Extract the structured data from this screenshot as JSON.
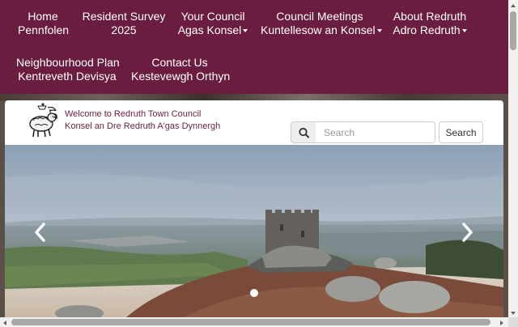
{
  "nav": {
    "items": [
      {
        "line1": "Home",
        "line2": "Pennfolen",
        "dropdown": false
      },
      {
        "line1": "Resident Survey",
        "line2": "2025",
        "dropdown": false
      },
      {
        "line1": "Your Council",
        "line2": "Agas Konsel",
        "dropdown": true
      },
      {
        "line1": "Council Meetings",
        "line2": "Kuntellesow an Konsel",
        "dropdown": true
      },
      {
        "line1": "About Redruth",
        "line2": "Adro Redruth",
        "dropdown": true
      },
      {
        "line1": "Neighbourhood Plan",
        "line2": "Kentreveth Devisya",
        "dropdown": false
      },
      {
        "line1": "Contact Us",
        "line2": "Kestevewgh Orthyn",
        "dropdown": false
      }
    ]
  },
  "header": {
    "title": "Welcome to Redruth Town Council",
    "subtitle": "Konsel an Dre Redruth A'gas Dynnergh",
    "logo_icon": "ram-crest-icon"
  },
  "search": {
    "placeholder": "Search",
    "value": "",
    "button_label": "Search",
    "icon": "search-icon"
  },
  "carousel": {
    "prev_icon": "chevron-left-icon",
    "next_icon": "chevron-right-icon",
    "slide_count": 1,
    "active_slide": 1
  },
  "colors": {
    "brand": "#6b1d40",
    "nav_text": "#ffffff"
  }
}
